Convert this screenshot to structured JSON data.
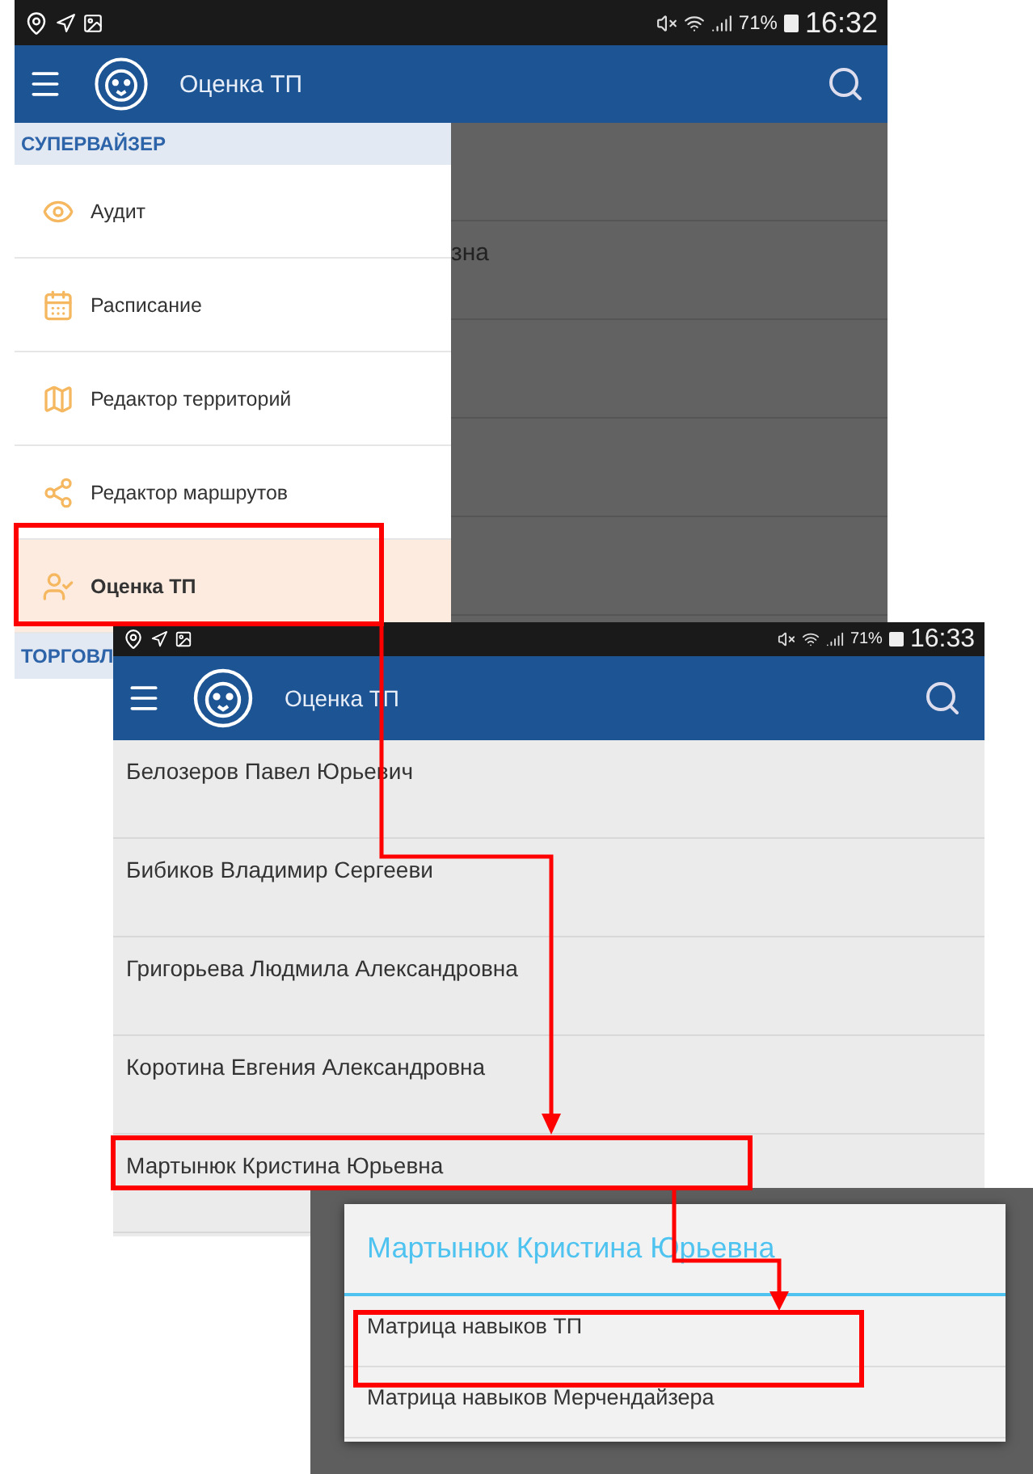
{
  "screens": [
    {
      "kind": "drawer",
      "status_bar": {
        "battery": "71%",
        "time": "16:32"
      },
      "app_bar": {
        "title": "Оценка ТП"
      },
      "drawer": {
        "sections": [
          {
            "title": "СУПЕРВАЙЗЕР",
            "items": [
              {
                "label": "Аудит",
                "selected": false
              },
              {
                "label": "Расписание",
                "selected": false
              },
              {
                "label": "Редактор территорий",
                "selected": false
              },
              {
                "label": "Редактор маршрутов",
                "selected": false
              },
              {
                "label": "Оценка ТП",
                "selected": true
              }
            ]
          },
          {
            "title": "ТОРГОВЛ"
          }
        ]
      },
      "behind_text": "зна"
    },
    {
      "kind": "list",
      "status_bar": {
        "battery": "71%",
        "time": "16:33"
      },
      "app_bar": {
        "title": "Оценка ТП"
      },
      "rows": [
        {
          "name": "Белозеров Павел Юрьевич"
        },
        {
          "name": "Бибиков Владимир Сергееви"
        },
        {
          "name": "Григорьева Людмила Александровна"
        },
        {
          "name": "Коротина Евгения Александровна"
        },
        {
          "name": "Мартынюк Кристина Юрьевна"
        }
      ]
    },
    {
      "kind": "dialog",
      "dialog": {
        "title": "Мартынюк Кристина Юрьевна",
        "options": [
          {
            "label": "Матрица навыков ТП"
          },
          {
            "label": "Матрица навыков Мерчендайзера"
          }
        ]
      }
    }
  ]
}
